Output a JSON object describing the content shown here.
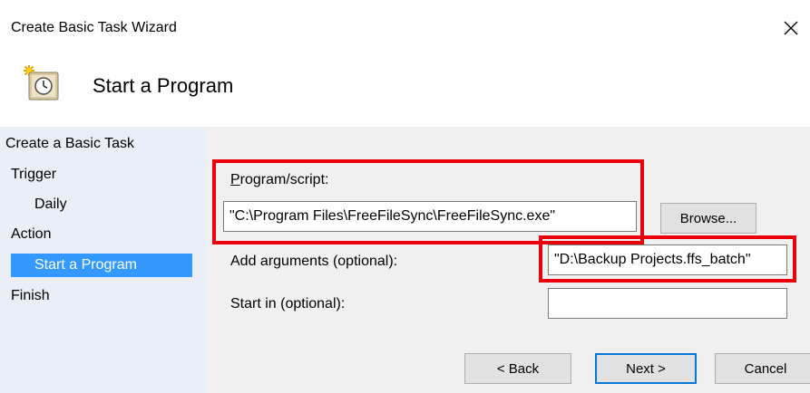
{
  "window": {
    "title": "Create Basic Task Wizard",
    "close_icon": "close-icon"
  },
  "header": {
    "title": "Start a Program",
    "icon": "task-scheduler-clock-icon"
  },
  "steps": [
    {
      "label": "Create a Basic Task"
    },
    {
      "label": "Trigger"
    },
    {
      "label": "Daily"
    },
    {
      "label": "Action"
    },
    {
      "label": "Start a Program",
      "selected": true
    },
    {
      "label": "Finish"
    }
  ],
  "form": {
    "program_label": "Program/script:",
    "program_value": "\"C:\\Program Files\\FreeFileSync\\FreeFileSync.exe\"",
    "browse_label": "Browse...",
    "arguments_label": "Add arguments (optional):",
    "arguments_value": "\"D:\\Backup Projects.ffs_batch\"",
    "start_in_label": "Start in (optional):",
    "start_in_value": ""
  },
  "buttons": {
    "back": "< Back",
    "next": "Next >",
    "cancel": "Cancel"
  },
  "colors": {
    "highlight": "#e8000b",
    "selection": "#3399ff",
    "nav_bg": "#e9eef7"
  }
}
